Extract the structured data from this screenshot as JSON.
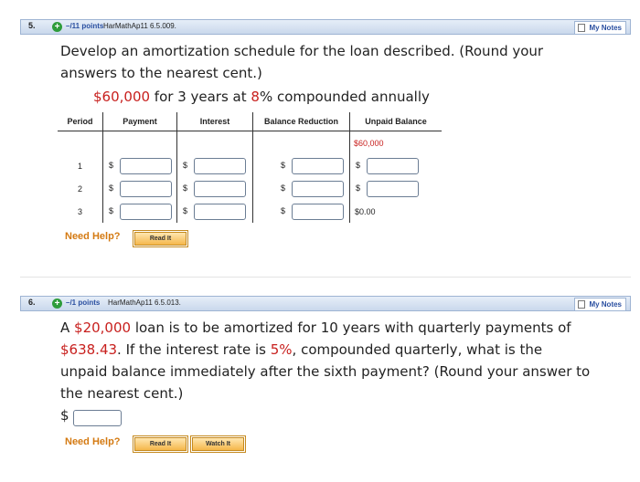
{
  "q5": {
    "number": "5.",
    "plus": "+",
    "points": "–/11 points",
    "source": "HarMathAp11 6.5.009.",
    "my_notes": "My Notes",
    "prompt_line1": "Develop an amortization schedule for the loan described. (Round your",
    "prompt_line2": "answers to the nearest cent.)",
    "loan_principal": "$60,000",
    "loan_mid": " for 3 years at ",
    "loan_rate": "8",
    "loan_tail": "% compounded annually",
    "table": {
      "headers": [
        "Period",
        "Payment",
        "Interest",
        "Balance Reduction",
        "Unpaid Balance"
      ],
      "currency": "$",
      "initial_balance": "$60,000",
      "periods": [
        "1",
        "2",
        "3"
      ],
      "final_balance": "$0.00"
    },
    "need_help": "Need Help?",
    "read_it": "Read It"
  },
  "q6": {
    "number": "6.",
    "plus": "+",
    "points": "–/1 points",
    "source": "HarMathAp11 6.5.013.",
    "my_notes": "My Notes",
    "t1": "A ",
    "amount": "$20,000",
    "t2": " loan is to be amortized for 10 years with quarterly payments of",
    "payment": "$638.43",
    "t3": ". If the interest rate is ",
    "rate": "5%",
    "t4": ", compounded quarterly, what is the",
    "line3": "unpaid balance immediately after the sixth payment? (Round your answer to",
    "line4": "the nearest cent.)",
    "answer_currency": "$",
    "need_help": "Need Help?",
    "read_it": "Read It",
    "watch_it": "Watch It"
  },
  "colors": {
    "accent_red": "#c8201e",
    "bar_blue": "#c9d8ec",
    "help_orange": "#d47a12",
    "button_orange": "#f5b74a"
  }
}
